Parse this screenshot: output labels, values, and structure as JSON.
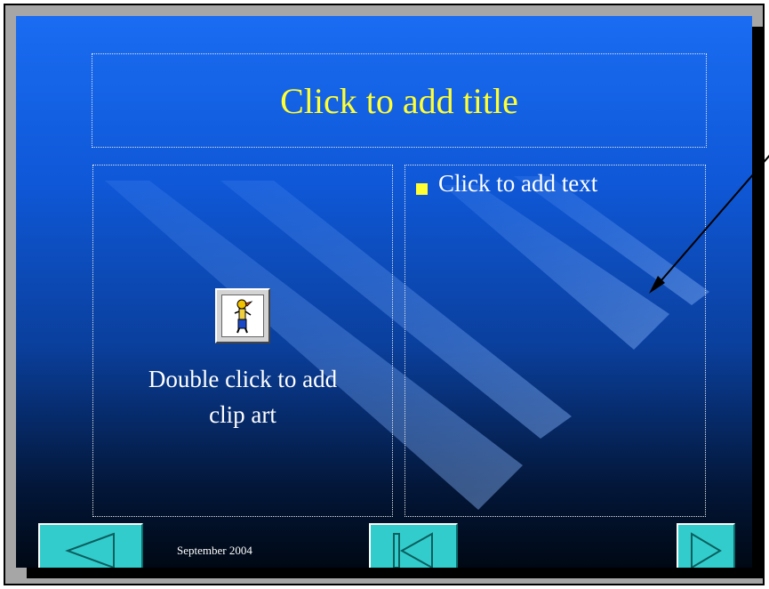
{
  "slide": {
    "title_placeholder": "Click to add title",
    "body_placeholder": "Click to add text",
    "clipart_placeholder_line1": "Double click to add",
    "clipart_placeholder_line2": "clip art",
    "footer_date": "September 2004"
  },
  "icons": {
    "clipart": "clip-art-figure-icon",
    "prev": "triangle-left-icon",
    "first": "bar-triangle-left-icon",
    "next": "triangle-right-icon",
    "bullet": "square-bullet-icon"
  },
  "colors": {
    "title_text": "#ffff33",
    "bullet": "#ffff33",
    "nav_button": "#33cccc",
    "background_top": "#1a6cf2",
    "background_bottom": "#000814"
  }
}
